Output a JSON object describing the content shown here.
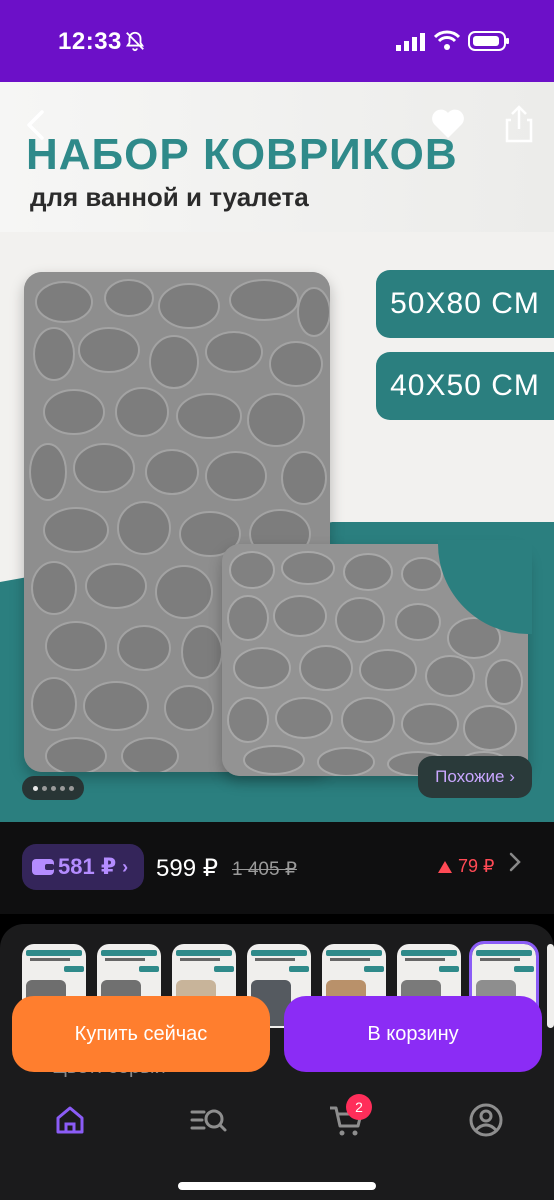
{
  "status_bar": {
    "time": "12:33"
  },
  "product": {
    "banner_title": "НАБОР КОВРИКОВ",
    "banner_subtitle": "для ванной и туалета",
    "sizes": [
      "50X80 CM",
      "40X50 CM"
    ],
    "gallery_position": 1,
    "gallery_total": 5,
    "similar_label": "Похожие ›"
  },
  "price": {
    "wallet_price": "581 ₽",
    "current": "599 ₽",
    "old": "1 405 ₽",
    "drop": "79 ₽"
  },
  "thumbnails": {
    "count_visible": 8,
    "selected_index": 7,
    "label": "Цвет: серый"
  },
  "actions": {
    "buy_now": "Купить сейчас",
    "add_to_cart": "В корзину"
  },
  "nav": {
    "items": [
      "home-icon",
      "catalog-search-icon",
      "cart-icon",
      "profile-icon"
    ],
    "cart_badge": "2"
  },
  "colors": {
    "status_bar": "#6c10c8",
    "teal": "#2b7f7f",
    "buy_now": "#ff7e2e",
    "add_to_cart": "#8b2cf5",
    "price_drop": "#ff4a55"
  }
}
